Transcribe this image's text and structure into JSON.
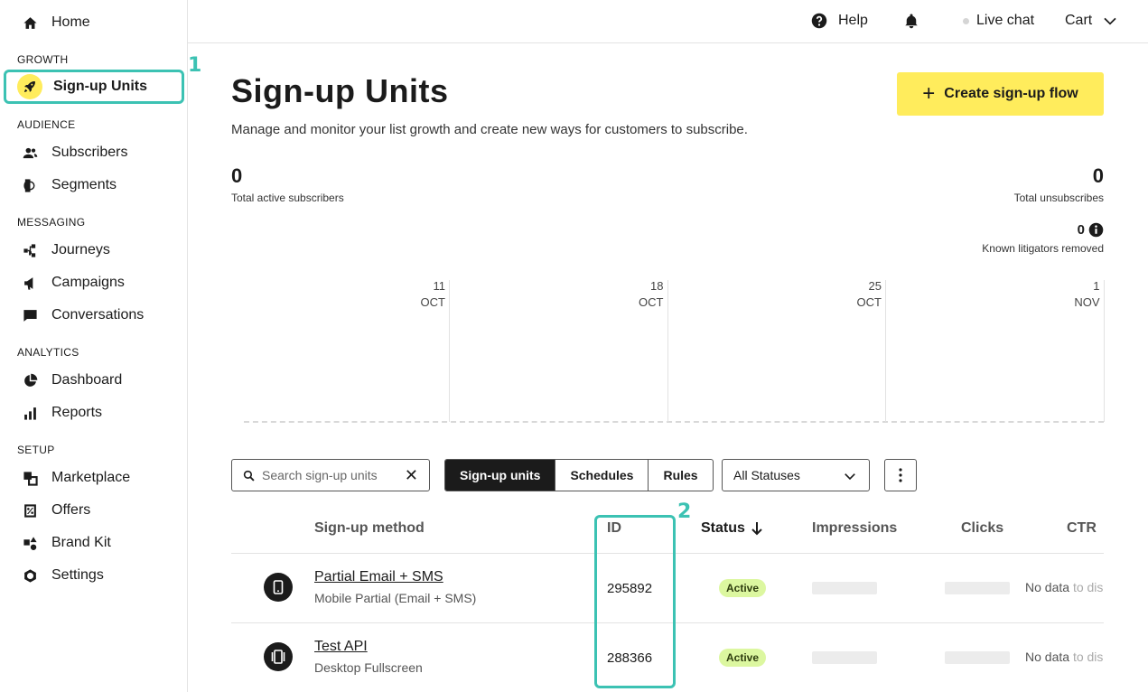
{
  "sidebar": {
    "home": "Home",
    "sections": {
      "growth": "GROWTH",
      "audience": "AUDIENCE",
      "messaging": "MESSAGING",
      "analytics": "ANALYTICS",
      "setup": "SETUP"
    },
    "items": {
      "signup_units": "Sign-up Units",
      "subscribers": "Subscribers",
      "segments": "Segments",
      "journeys": "Journeys",
      "campaigns": "Campaigns",
      "conversations": "Conversations",
      "dashboard": "Dashboard",
      "reports": "Reports",
      "marketplace": "Marketplace",
      "offers": "Offers",
      "brand_kit": "Brand Kit",
      "settings": "Settings"
    },
    "active_item": "Sign-up Units",
    "step_badge": "1"
  },
  "topbar": {
    "help": "Help",
    "live_chat": "Live chat",
    "cart": "Cart"
  },
  "page": {
    "title": "Sign-up Units",
    "description": "Manage and monitor your list growth and create new ways for customers to subscribe.",
    "create_button": "Create sign-up flow"
  },
  "stats": {
    "total_active_subscribers": {
      "value": "0",
      "label": "Total active subscribers"
    },
    "total_unsubscribes": {
      "value": "0",
      "label": "Total unsubscribes"
    },
    "known_litigators_removed": {
      "value": "0",
      "label": "Known litigators removed"
    }
  },
  "chart_data": {
    "type": "line",
    "x": [
      {
        "day": "11",
        "month": "OCT"
      },
      {
        "day": "18",
        "month": "OCT"
      },
      {
        "day": "25",
        "month": "OCT"
      },
      {
        "day": "1",
        "month": "NOV"
      }
    ],
    "series": [],
    "grid": true
  },
  "filters": {
    "search_placeholder": "Search sign-up units",
    "tabs": [
      "Sign-up units",
      "Schedules",
      "Rules"
    ],
    "active_tab": "Sign-up units",
    "status_select": "All Statuses"
  },
  "table": {
    "step_badge": "2",
    "columns": [
      "Sign-up method",
      "ID",
      "Status",
      "Impressions",
      "Clicks",
      "CTR"
    ],
    "sorted_column": "Status",
    "rows": [
      {
        "name": "Partial Email + SMS",
        "subtitle": "Mobile Partial (Email + SMS)",
        "id": "295892",
        "status": "Active",
        "ctr_prefix": "No data ",
        "ctr_faded": "to dis",
        "icon": "mobile-icon"
      },
      {
        "name": "Test API",
        "subtitle": "Desktop Fullscreen",
        "id": "288366",
        "status": "Active",
        "ctr_prefix": "No data ",
        "ctr_faded": "to dis",
        "icon": "fullscreen-icon"
      }
    ]
  },
  "colors": {
    "accent_yellow": "#ffec5c",
    "highlight_teal": "#3cc2b3",
    "active_badge": "#dcf7a0"
  }
}
